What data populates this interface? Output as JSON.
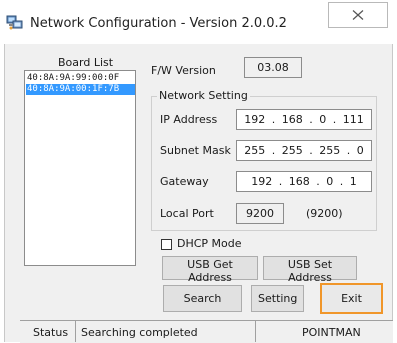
{
  "window": {
    "title": "Network Configuration - Version 2.0.0.2",
    "icon": "network-computers-icon"
  },
  "board_list": {
    "label": "Board List",
    "items": [
      {
        "text": "40:8A:9A:99:00:0F",
        "selected": false
      },
      {
        "text": "40:8A:9A:00:1F:7B",
        "selected": true
      }
    ]
  },
  "firmware": {
    "label": "F/W Version",
    "value": "03.08"
  },
  "network_setting": {
    "caption": "Network Setting",
    "ip_label": "IP Address",
    "ip_value": "192 . 168 . 0 . 111",
    "subnet_label": "Subnet Mask",
    "subnet_value": "255 . 255 . 255 . 0",
    "gateway_label": "Gateway",
    "gateway_value": "192 . 168 . 0 . 1",
    "port_label": "Local Port",
    "port_value": "9200",
    "port_hint": "(9200)"
  },
  "dhcp": {
    "label": "DHCP Mode",
    "checked": false
  },
  "buttons": {
    "usb_get": "USB Get Address",
    "usb_set": "USB Set Address",
    "search": "Search",
    "setting": "Setting",
    "exit": "Exit"
  },
  "status_bar": {
    "label": "Status",
    "message": "Searching completed",
    "brand": "POINTMAN"
  },
  "colors": {
    "selection": "#3399ff",
    "exit_highlight": "#f0962a",
    "dialog_bg": "#f0f0f0"
  }
}
